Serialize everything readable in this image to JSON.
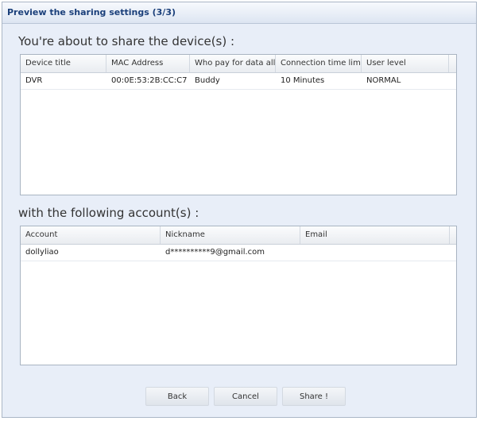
{
  "dialog": {
    "title": "Preview the sharing settings (3/3)"
  },
  "devices_section": {
    "heading": "You're about to share the device(s) :",
    "columns": [
      "Device title",
      "MAC Address",
      "Who pay for data allc",
      "Connection time limit",
      "User level"
    ],
    "rows": [
      [
        "DVR",
        "00:0E:53:2B:CC:C7",
        "Buddy",
        "10 Minutes",
        "NORMAL"
      ]
    ]
  },
  "accounts_section": {
    "heading": "with the following account(s) :",
    "columns": [
      "Account",
      "Nickname",
      "Email"
    ],
    "rows": [
      [
        "dollyliao",
        "d**********9@gmail.com",
        ""
      ]
    ]
  },
  "buttons": {
    "back": "Back",
    "cancel": "Cancel",
    "share": "Share !"
  }
}
